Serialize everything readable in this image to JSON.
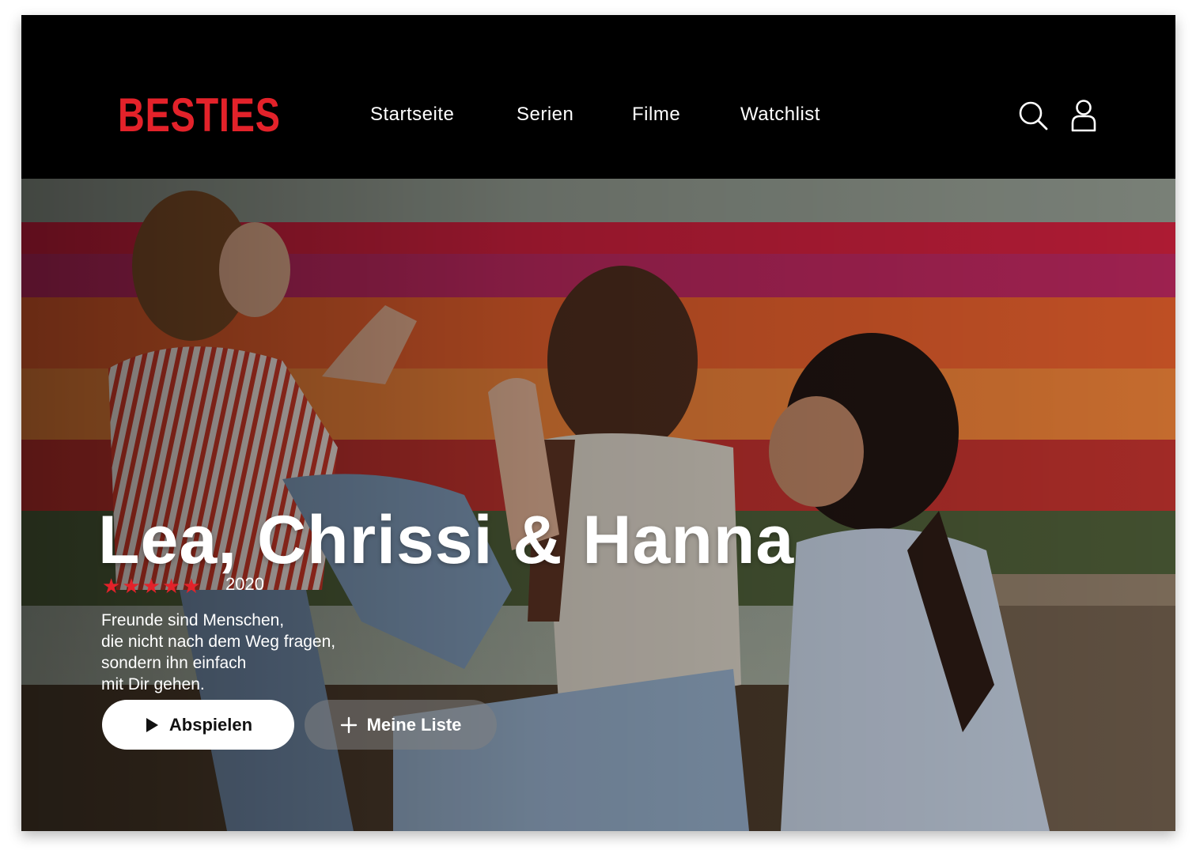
{
  "brand": {
    "logo_text": "BESTIES",
    "accent": "#e3222a"
  },
  "nav": {
    "items": [
      {
        "label": "Startseite"
      },
      {
        "label": "Serien"
      },
      {
        "label": "Filme"
      },
      {
        "label": "Watchlist"
      }
    ]
  },
  "header_icons": {
    "search": "search-icon",
    "profile": "user-icon"
  },
  "hero": {
    "title": "Lea, Chrissi & Hanna",
    "rating_stars": 5,
    "year": "2020",
    "description_lines": [
      "Freunde sind Menschen,",
      "die nicht nach dem Weg fragen,",
      "sondern ihn einfach",
      "mit Dir gehen."
    ],
    "play_label": "Abspielen",
    "list_label": "Meine Liste"
  }
}
